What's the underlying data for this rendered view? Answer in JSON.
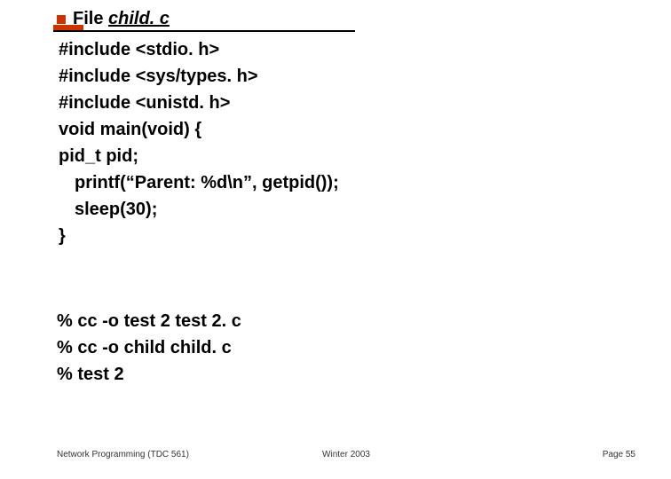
{
  "title": {
    "prefix": "File ",
    "filename": "child. c"
  },
  "code": [
    "#include <stdio. h>",
    "#include <sys/types. h>",
    "#include <unistd. h>",
    "void main(void) {",
    "pid_t pid;",
    "  printf(“Parent: %d\\n”, getpid());",
    "  sleep(30);",
    "}"
  ],
  "commands": [
    "% cc -o test 2 test 2. c",
    "% cc -o child child. c",
    "% test 2"
  ],
  "footer": {
    "left": "Network Programming (TDC 561)",
    "center": "Winter  2003",
    "right": "Page 55"
  },
  "accent_color": "#cc3300"
}
